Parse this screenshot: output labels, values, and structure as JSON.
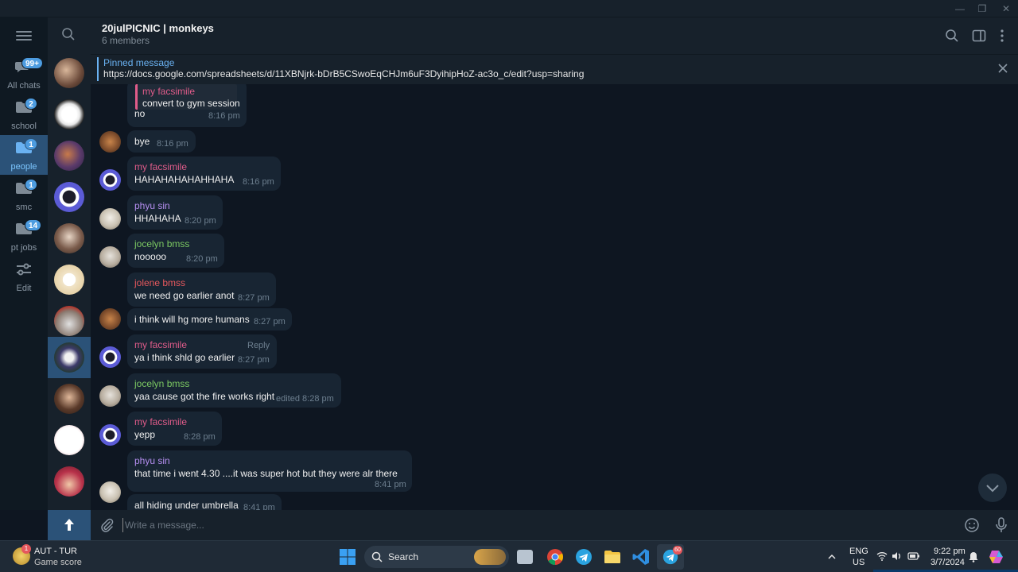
{
  "window": {
    "minimize": "—",
    "maximize": "❐",
    "close": "✕"
  },
  "folders": [
    {
      "label": "All chats",
      "badge": "99+"
    },
    {
      "label": "school",
      "badge": "2"
    },
    {
      "label": "people",
      "badge": "1"
    },
    {
      "label": "smc",
      "badge": "1"
    },
    {
      "label": "pt jobs",
      "badge": "14"
    },
    {
      "label": "Edit",
      "badge": ""
    }
  ],
  "chat": {
    "title": "20julPICNIC | monkeys",
    "subtitle": "6 members"
  },
  "pinned": {
    "title": "Pinned message",
    "text": "https://docs.google.com/spreadsheets/d/11XBNjrk-bDrB5CSwoEqCHJm6uF3DyihipHoZ-ac3o_c/edit?usp=sharing"
  },
  "messages": [
    {
      "sender": "my facsimile",
      "quote_text": "convert to gym session",
      "text": "no",
      "time": "8:16 pm"
    },
    {
      "sender": "",
      "text": "bye",
      "time": "8:16 pm"
    },
    {
      "sender": "my facsimile",
      "text": "HAHAHAHAHAHHAHA",
      "time": "8:16 pm"
    },
    {
      "sender": "phyu sin",
      "text": "HHAHAHA",
      "time": "8:20 pm"
    },
    {
      "sender": "jocelyn bmss",
      "text": "nooooo",
      "time": "8:20 pm"
    },
    {
      "sender": "jolene bmss",
      "text": "we need go earlier anot",
      "time": "8:27 pm"
    },
    {
      "sender": "",
      "text": "i think will hg more humans",
      "time": "8:27 pm"
    },
    {
      "sender": "my facsimile",
      "text": "ya i think shld go earlier",
      "time": "8:27 pm",
      "reply": "Reply"
    },
    {
      "sender": "jocelyn bmss",
      "text": "yaa cause got the fire works right",
      "time": "edited 8:28 pm"
    },
    {
      "sender": "my facsimile",
      "text": "yepp",
      "time": "8:28 pm"
    },
    {
      "sender": "phyu sin",
      "text": "that time i went 4.30 ....it was super hot but they were alr there",
      "time": "8:41 pm"
    },
    {
      "sender": "",
      "text": "all hiding under umbrella",
      "time": "8:41 pm"
    }
  ],
  "composer": {
    "placeholder": "Write a message..."
  },
  "taskbar": {
    "weather_title": "AUT - TUR",
    "weather_sub": "Game score",
    "weather_badge": "1",
    "search_label": "Search",
    "telegram_badge": "60",
    "lang_top": "ENG",
    "lang_bottom": "US",
    "time": "9:22 pm",
    "date": "3/7/2024"
  },
  "colors": {
    "bg": "#0e1621",
    "panel": "#17212b",
    "accent": "#6ab2f2",
    "bubble": "#182533",
    "pink": "#e05c8a",
    "purple": "#b58ef0",
    "green": "#7bc862",
    "red": "#e5585d"
  }
}
